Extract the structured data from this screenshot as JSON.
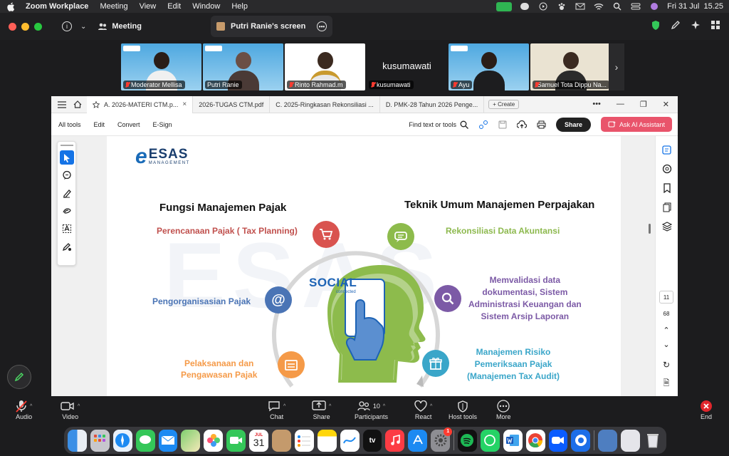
{
  "menubar": {
    "app_name": "Zoom Workplace",
    "items": [
      "Meeting",
      "View",
      "Edit",
      "Window",
      "Help"
    ],
    "datetime": "Fri 31 Jul  15.25"
  },
  "zoom_header": {
    "meeting_label": "Meeting",
    "share_label": "Putri Ranie's screen"
  },
  "participants": [
    {
      "name": "Moderator Mellisa",
      "muted": true
    },
    {
      "name": "Putri Ranie",
      "muted": false,
      "active": true
    },
    {
      "name": "Rinto Rahmad.m",
      "muted": true
    },
    {
      "name": "kusumawati",
      "muted": true,
      "video_off_label": "kusumawati"
    },
    {
      "name": "Ayu",
      "muted": true
    },
    {
      "name": "Samuel Tota Dippu Na...",
      "muted": true
    }
  ],
  "acrobat": {
    "tabs": [
      {
        "label": "A. 2026-MATERI CTM.p...",
        "active": true
      },
      {
        "label": "2026-TUGAS CTM.pdf"
      },
      {
        "label": "C. 2025-Ringkasan Rekonsiliasi ..."
      },
      {
        "label": "D. PMK-28 Tahun 2026 Penge..."
      }
    ],
    "create_label": "Create",
    "toolbar": {
      "all_tools": "All tools",
      "edit": "Edit",
      "convert": "Convert",
      "esign": "E-Sign",
      "find": "Find text or tools",
      "share": "Share",
      "ai": "Ask AI Assistant"
    },
    "page_current": "11",
    "page_total": "68"
  },
  "slide": {
    "logo_big": "ESAS",
    "logo_small": "MANAGEMENT",
    "watermark": "ESAS",
    "heading_left": "Fungsi Manajemen Pajak",
    "heading_right": "Teknik Umum Manajemen Perpajakan",
    "center_text": "SOCIAL",
    "center_sub": "connected",
    "left_items": [
      {
        "text": "Perencanaan Pajak ( Tax Planning)",
        "color": "#c0504d"
      },
      {
        "text": "Pengorganisasian Pajak",
        "color": "#4a74b5"
      },
      {
        "text": "Pelaksanaan dan\nPengawasan Pajak",
        "color": "#f59a48"
      }
    ],
    "right_items": [
      {
        "text": "Rekonsiliasi Data Akuntansi",
        "color": "#8db94e"
      },
      {
        "text": "Memvalidasi data\ndokumentasi, Sistem\nAdministrasi Keuangan dan\nSistem Arsip Laporan",
        "color": "#7c5aa6"
      },
      {
        "text": "Manajemen Risiko\nPemeriksaan Pajak\n(Manajemen Tax Audit)",
        "color": "#3aa6c9"
      }
    ]
  },
  "controls": {
    "audio": "Audio",
    "video": "Video",
    "chat": "Chat",
    "share": "Share",
    "participants": "Participants",
    "participants_count": "10",
    "react": "React",
    "host_tools": "Host tools",
    "more": "More",
    "end": "End"
  },
  "dock": {
    "calendar_month": "JUL",
    "calendar_day": "31",
    "tv_label": "tv",
    "settings_badge": "1"
  }
}
